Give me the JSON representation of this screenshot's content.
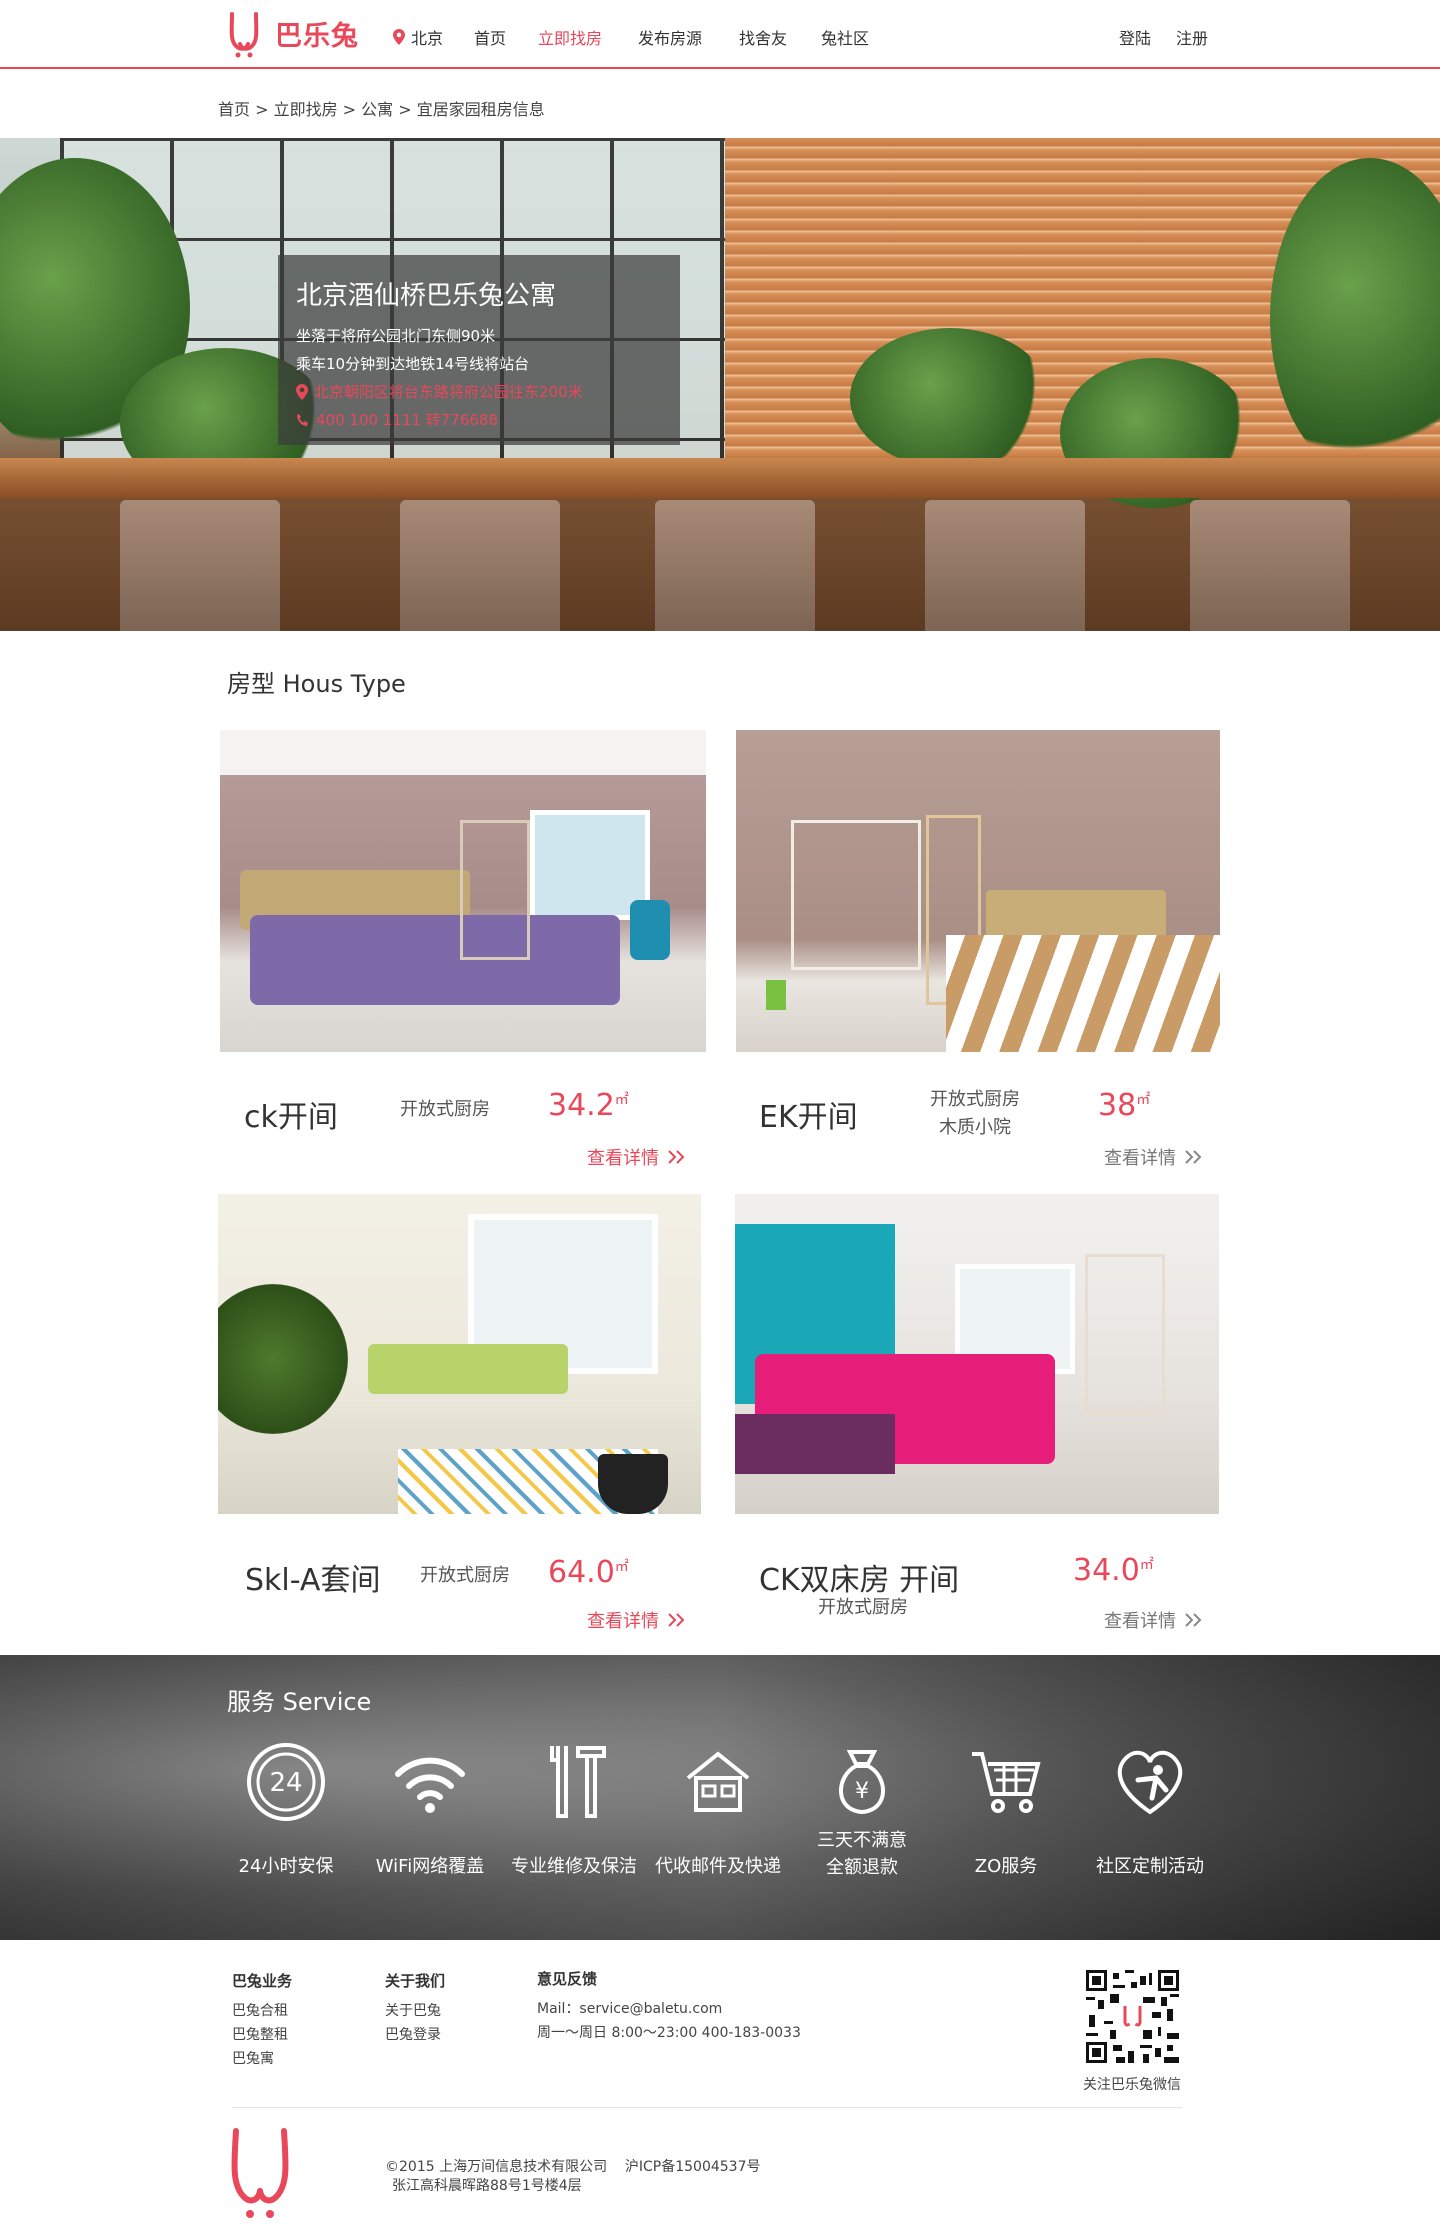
{
  "header": {
    "brand": "巴乐兔",
    "city": "北京",
    "nav": [
      "首页",
      "立即找房",
      "发布房源",
      "找舍友",
      "兔社区"
    ],
    "login": "登陆",
    "register": "注册"
  },
  "breadcrumb": "首页 > 立即找房 > 公寓 > 宜居家园租房信息",
  "hero": {
    "title": "北京酒仙桥巴乐兔公寓",
    "line1": "坐落于将府公园北门东侧90米",
    "line2": "乘车10分钟到达地铁14号线将站台",
    "address": "北京朝阳区将台东路将府公园往东200米",
    "phone": "400 100 1111 转776688"
  },
  "room_types": {
    "title": "房型 Hous Type",
    "rooms": [
      {
        "name": "ck开间",
        "features": [
          "开放式厨房"
        ],
        "area": "34.2",
        "unit": "㎡",
        "detail": "查看详情"
      },
      {
        "name": "EK开间",
        "features": [
          "开放式厨房",
          "木质小院"
        ],
        "area": "38",
        "unit": "㎡",
        "detail": "查看详情"
      },
      {
        "name": "Skl-A套间",
        "features": [
          "开放式厨房"
        ],
        "area": "64.0",
        "unit": "㎡",
        "detail": "查看详情"
      },
      {
        "name": "CK双床房 开间",
        "features": [
          "开放式厨房"
        ],
        "area": "34.0",
        "unit": "㎡",
        "detail": "查看详情"
      }
    ]
  },
  "service": {
    "title": "服务 Service",
    "items": [
      {
        "icon": "clock-24-icon",
        "label": "24小时安保",
        "clock_text": "24"
      },
      {
        "icon": "wifi-icon",
        "label": "WiFi网络覆盖"
      },
      {
        "icon": "tools-icon",
        "label": "专业维修及保洁"
      },
      {
        "icon": "house-icon",
        "label": "代收邮件及快递"
      },
      {
        "icon": "money-bag-icon",
        "label": "三天不满意\n全额退款",
        "label1": "三天不满意",
        "label2": "全额退款"
      },
      {
        "icon": "cart-icon",
        "label": "ZO服务"
      },
      {
        "icon": "heart-person-icon",
        "label": "社区定制活动"
      }
    ]
  },
  "footer": {
    "col1": {
      "title": "巴兔业务",
      "links": [
        "巴兔合租",
        "巴兔整租",
        "巴兔寓"
      ]
    },
    "col2": {
      "title": "关于我们",
      "links": [
        "关于巴兔",
        "巴兔登录"
      ]
    },
    "col3": {
      "title": "意见反馈",
      "mail": "Mail：service@baletu.com",
      "hours": "周一～周日 8:00～23:00 400-183-0033"
    },
    "qr_label": "关注巴乐兔微信",
    "copyright": "©2015 上海万间信息技术有限公司    沪ICP备15004537号",
    "address": "张江高科晨晖路88号1号楼4层"
  },
  "colors": {
    "accent": "#e8485a"
  }
}
